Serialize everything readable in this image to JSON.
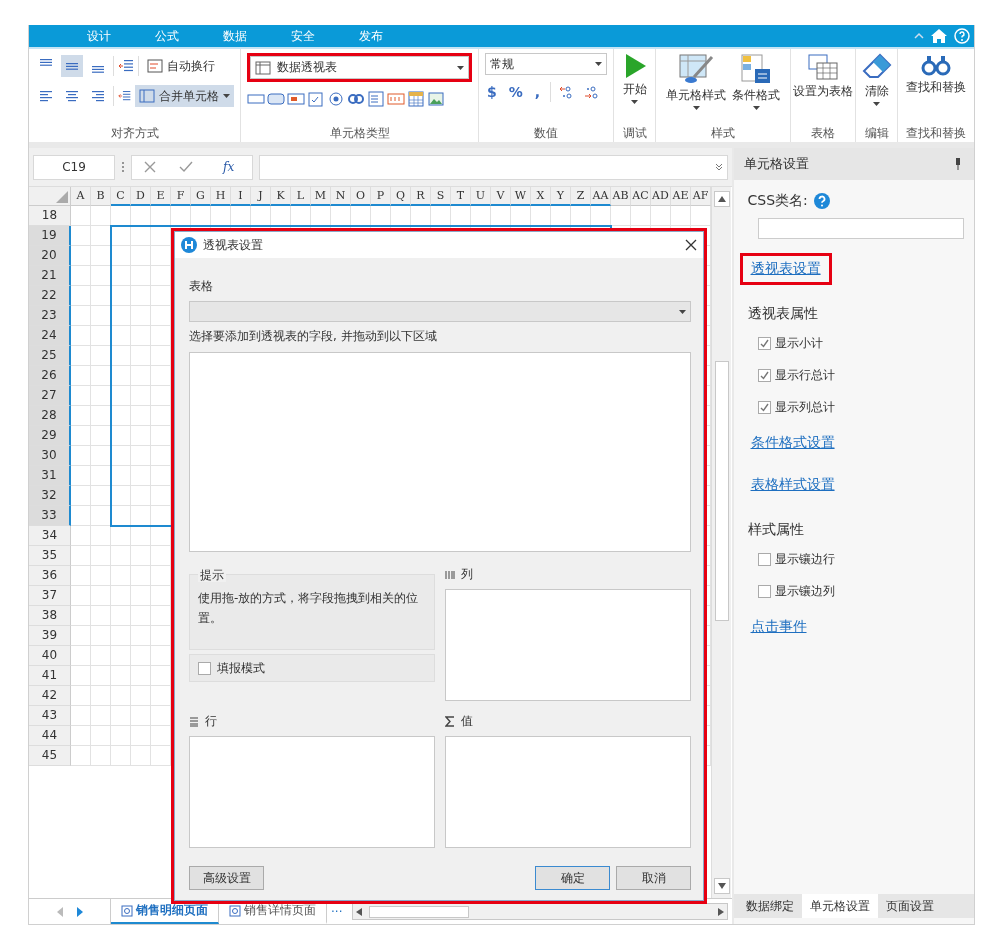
{
  "menu_tabs": [
    "设计",
    "公式",
    "数据",
    "安全",
    "发布"
  ],
  "ribbon": {
    "vertical_align": [
      {
        "selected": false
      },
      {
        "selected": true
      },
      {
        "selected": false
      }
    ],
    "horizontal_align": [
      {
        "selected": false
      },
      {
        "selected": false
      },
      {
        "selected": false
      }
    ],
    "wrap_text": {
      "label": "自动换行",
      "selected": false
    },
    "merge_cells": {
      "label": "合并单元格",
      "selected": true
    },
    "cell_type": {
      "value": "数据透视表",
      "highlighted": true
    },
    "number_format": {
      "value": "常规"
    },
    "number_buttons": [
      "$",
      "%",
      ","
    ],
    "run_button": "开始",
    "style_buttons": [
      "单元格样式",
      "条件格式"
    ],
    "table_button": "设置为表格",
    "clear_button": "清除",
    "find_button": "查找和替换",
    "group_labels": [
      "对齐方式",
      "单元格类型",
      "数值",
      "调试",
      "样式",
      "表格",
      "编辑",
      "查找和替换"
    ]
  },
  "formula_bar": {
    "cell_ref": "C19",
    "function_label": "fx"
  },
  "sheet": {
    "columns": [
      {
        "label": "A",
        "selected": false
      },
      {
        "label": "B",
        "selected": false
      },
      {
        "label": "C",
        "selected": true
      },
      {
        "label": "D",
        "selected": true
      },
      {
        "label": "E",
        "selected": true
      },
      {
        "label": "F",
        "selected": true
      },
      {
        "label": "G",
        "selected": true
      },
      {
        "label": "H",
        "selected": true
      },
      {
        "label": "I",
        "selected": true
      },
      {
        "label": "J",
        "selected": true
      },
      {
        "label": "K",
        "selected": true
      },
      {
        "label": "L",
        "selected": true
      },
      {
        "label": "M",
        "selected": true
      },
      {
        "label": "N",
        "selected": true
      },
      {
        "label": "O",
        "selected": true
      },
      {
        "label": "P",
        "selected": true
      },
      {
        "label": "Q",
        "selected": true
      },
      {
        "label": "R",
        "selected": true
      },
      {
        "label": "S",
        "selected": true
      },
      {
        "label": "T",
        "selected": true
      },
      {
        "label": "U",
        "selected": true
      },
      {
        "label": "V",
        "selected": true
      },
      {
        "label": "W",
        "selected": true
      },
      {
        "label": "X",
        "selected": true
      },
      {
        "label": "Y",
        "selected": true
      },
      {
        "label": "Z",
        "selected": true
      },
      {
        "label": "AA",
        "selected": true
      },
      {
        "label": "AB",
        "selected": false
      },
      {
        "label": "AC",
        "selected": false
      },
      {
        "label": "AD",
        "selected": false
      },
      {
        "label": "AE",
        "selected": false
      },
      {
        "label": "AF",
        "selected": false
      }
    ],
    "rows": [
      {
        "label": "18",
        "selected": false
      },
      {
        "label": "19",
        "selected": true
      },
      {
        "label": "20",
        "selected": true
      },
      {
        "label": "21",
        "selected": true
      },
      {
        "label": "22",
        "selected": true
      },
      {
        "label": "23",
        "selected": true
      },
      {
        "label": "24",
        "selected": true
      },
      {
        "label": "25",
        "selected": true
      },
      {
        "label": "26",
        "selected": true
      },
      {
        "label": "27",
        "selected": true
      },
      {
        "label": "28",
        "selected": true
      },
      {
        "label": "29",
        "selected": true
      },
      {
        "label": "30",
        "selected": true
      },
      {
        "label": "31",
        "selected": true
      },
      {
        "label": "32",
        "selected": true
      },
      {
        "label": "33",
        "selected": true
      },
      {
        "label": "34",
        "selected": false
      },
      {
        "label": "35",
        "selected": false
      },
      {
        "label": "36",
        "selected": false
      },
      {
        "label": "37",
        "selected": false
      },
      {
        "label": "38",
        "selected": false
      },
      {
        "label": "39",
        "selected": false
      },
      {
        "label": "40",
        "selected": false
      },
      {
        "label": "41",
        "selected": false
      },
      {
        "label": "42",
        "selected": false
      },
      {
        "label": "43",
        "selected": false
      },
      {
        "label": "44",
        "selected": false
      },
      {
        "label": "45",
        "selected": false
      }
    ]
  },
  "sheet_tabs": [
    {
      "label": "销售明细页面",
      "selected": true
    },
    {
      "label": "销售详情页面",
      "selected": false
    }
  ],
  "more_tabs": "···",
  "side_panel": {
    "title": "单元格设置",
    "css_label": "CSS类名:",
    "sections": [
      {
        "kind": "link",
        "label": "透视表设置",
        "highlighted": true
      },
      {
        "kind": "heading",
        "label": "透视表属性"
      },
      {
        "kind": "checkbox",
        "label": "显示小计",
        "checked": true
      },
      {
        "kind": "checkbox",
        "label": "显示行总计",
        "checked": true
      },
      {
        "kind": "checkbox",
        "label": "显示列总计",
        "checked": true
      },
      {
        "kind": "link",
        "label": "条件格式设置",
        "highlighted": false
      },
      {
        "kind": "link",
        "label": "表格样式设置",
        "highlighted": false
      },
      {
        "kind": "heading",
        "label": "样式属性"
      },
      {
        "kind": "checkbox",
        "label": "显示镶边行",
        "checked": false
      },
      {
        "kind": "checkbox",
        "label": "显示镶边列",
        "checked": false
      },
      {
        "kind": "link",
        "label": "点击事件",
        "highlighted": false
      }
    ],
    "tabs": [
      {
        "label": "数据绑定",
        "selected": false
      },
      {
        "label": "单元格设置",
        "selected": true
      },
      {
        "label": "页面设置",
        "selected": false
      }
    ]
  },
  "dialog": {
    "title": "透视表设置",
    "highlighted": true,
    "table_label": "表格",
    "instruction": "选择要添加到透视表的字段, 并拖动到以下区域",
    "tip_title": "提示",
    "tip_text": "使用拖-放的方式，将字段拖拽到相关的位置。",
    "fill_mode": {
      "label": "填报模式",
      "checked": false
    },
    "zones": [
      {
        "kind": "columns",
        "label": "列"
      },
      {
        "kind": "rows",
        "label": "行"
      },
      {
        "kind": "values",
        "label": "值"
      }
    ],
    "advanced_button": "高级设置",
    "ok_button": "确定",
    "cancel_button": "取消"
  }
}
